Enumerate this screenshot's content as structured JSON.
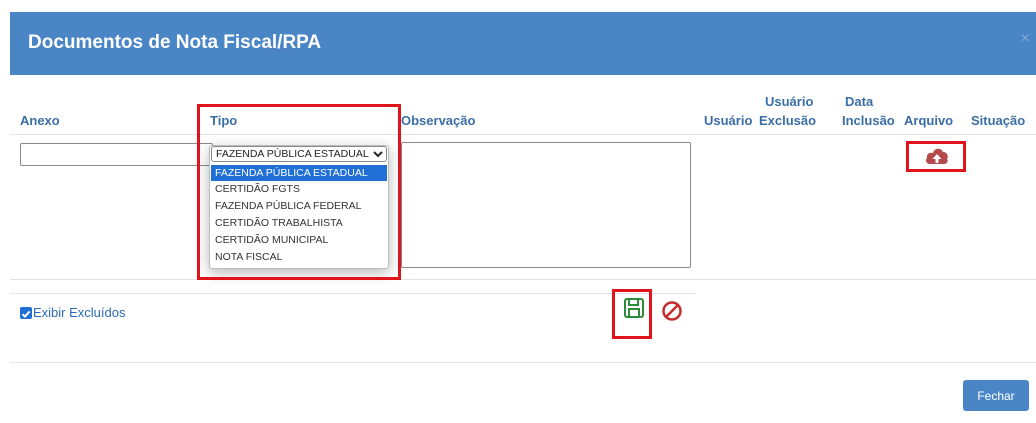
{
  "modal": {
    "title": "Documentos de Nota Fiscal/RPA",
    "close_label": "×",
    "accent_color": "#4a86c6"
  },
  "table": {
    "headers": {
      "anexo": "Anexo",
      "tipo": "Tipo",
      "observacao": "Observação",
      "usuario": "Usuário",
      "usuario_exclusao_1": "Usuário",
      "usuario_exclusao_2": "Exclusão",
      "data_inclusao_1": "Data",
      "data_inclusao_2": "Inclusão",
      "arquivo": "Arquivo",
      "situacao": "Situação"
    }
  },
  "tipo_select": {
    "selected": "FAZENDA PÚBLICA ESTADUAL",
    "options": [
      "FAZENDA PÚBLICA ESTADUAL",
      "CERTIDÃO FGTS",
      "FAZENDA PÚBLICA FEDERAL",
      "CERTIDÃO TRABALHISTA",
      "CERTIDÃO MUNICIPAL",
      "NOTA FISCAL"
    ]
  },
  "icons": {
    "upload": "cloud-upload-icon",
    "save": "floppy-disk-icon",
    "cancel": "ban-icon",
    "chevron": "chevron-down-icon",
    "check": "checkbox-checked-icon"
  },
  "colors": {
    "upload": "#b54a4a",
    "save": "#2e8b3e",
    "cancel": "#c42b2b",
    "highlight": "#e0141c"
  },
  "footer": {
    "exibir_excluidos_label": "Exibir Excluídos",
    "exibir_excluidos_checked": true,
    "fechar_label": "Fechar"
  }
}
